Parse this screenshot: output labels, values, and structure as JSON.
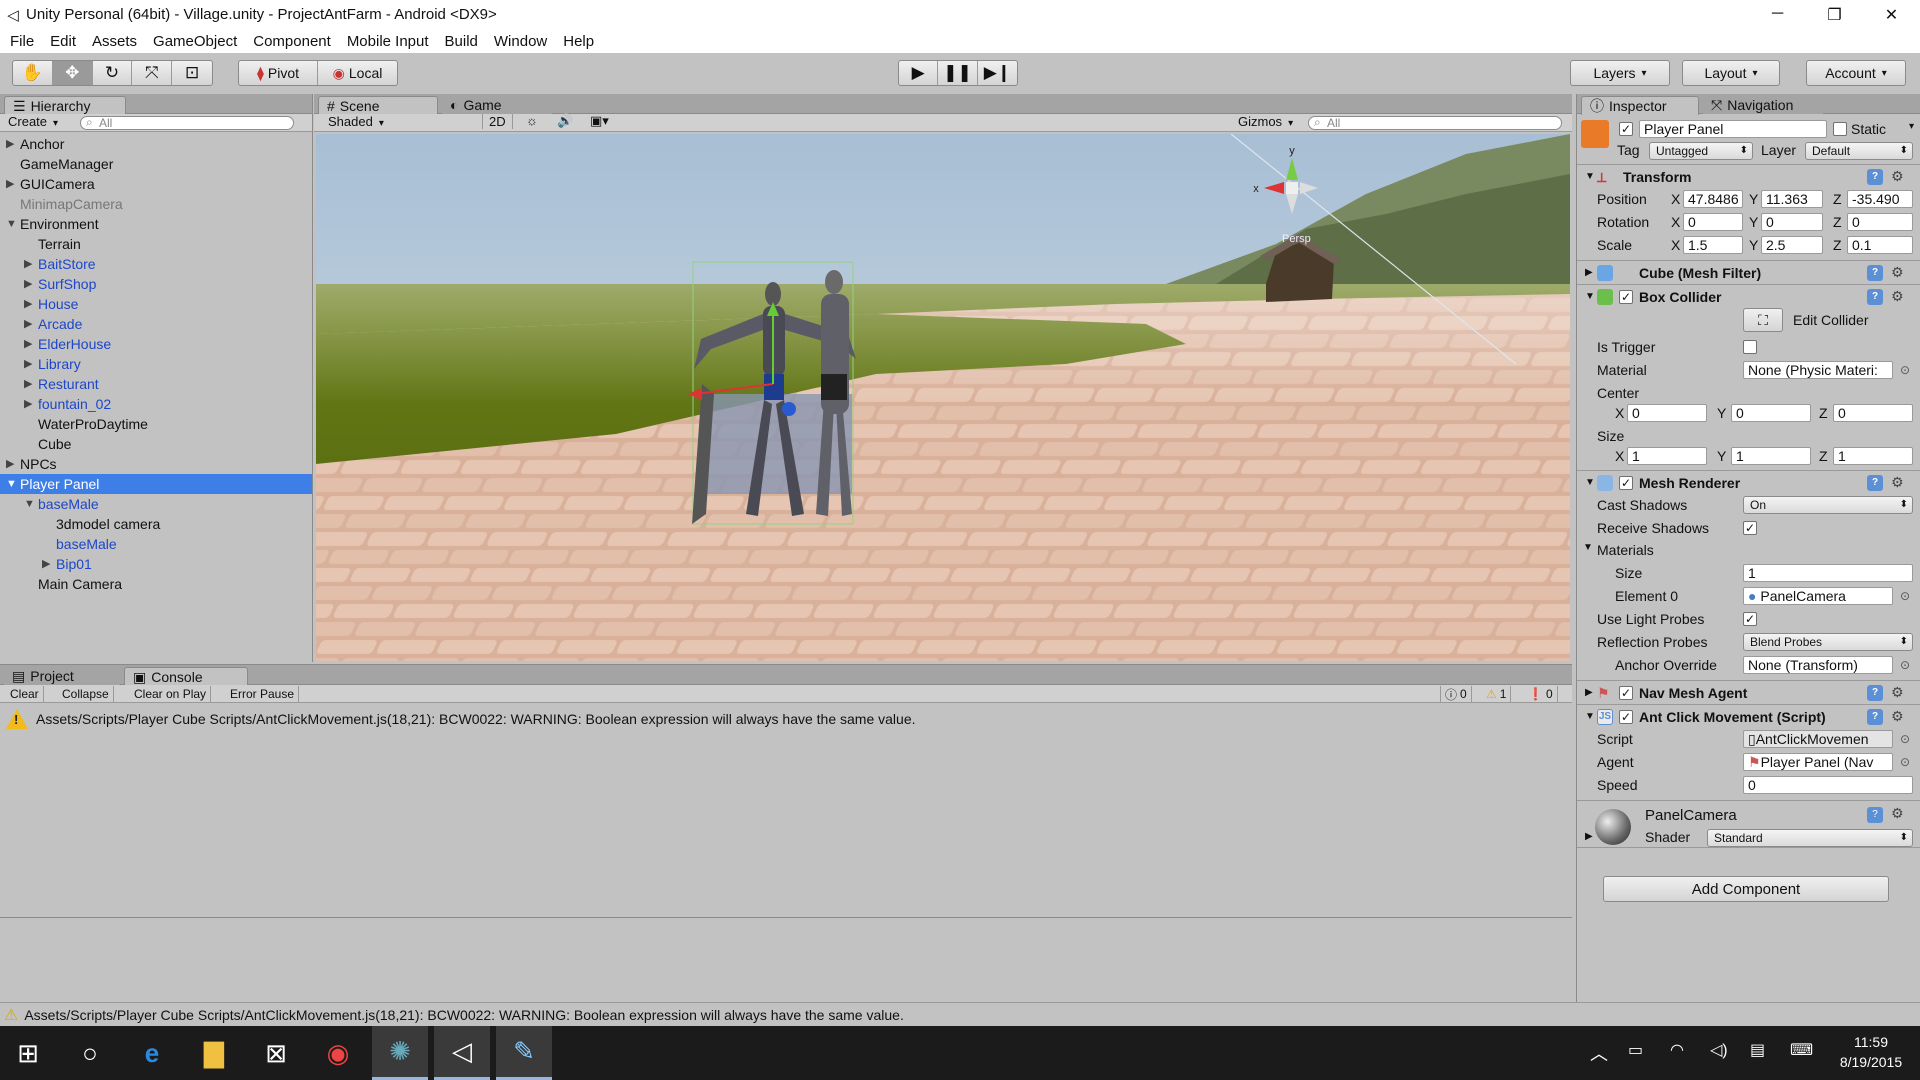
{
  "window": {
    "title": "Unity Personal (64bit) - Village.unity - ProjectAntFarm - Android <DX9>",
    "controls": [
      "─",
      "❐",
      "✕"
    ]
  },
  "menu": [
    "File",
    "Edit",
    "Assets",
    "GameObject",
    "Component",
    "Mobile Input",
    "Build",
    "Window",
    "Help"
  ],
  "toolbar": {
    "pivot": "Pivot",
    "local": "Local",
    "layers": "Layers",
    "layout": "Layout",
    "account": "Account"
  },
  "hierarchy": {
    "tab": "Hierarchy",
    "create": "Create",
    "search_placeholder": "All",
    "items": [
      {
        "label": "Anchor",
        "depth": 0,
        "arrow": "▶",
        "style": ""
      },
      {
        "label": "GameManager",
        "depth": 0,
        "arrow": "",
        "style": ""
      },
      {
        "label": "GUICamera",
        "depth": 0,
        "arrow": "▶",
        "style": ""
      },
      {
        "label": "MinimapCamera",
        "depth": 0,
        "arrow": "",
        "style": "gray"
      },
      {
        "label": "Environment",
        "depth": 0,
        "arrow": "▼",
        "style": ""
      },
      {
        "label": "Terrain",
        "depth": 1,
        "arrow": "",
        "style": ""
      },
      {
        "label": "BaitStore",
        "depth": 1,
        "arrow": "▶",
        "style": "blue"
      },
      {
        "label": "SurfShop",
        "depth": 1,
        "arrow": "▶",
        "style": "blue"
      },
      {
        "label": "House",
        "depth": 1,
        "arrow": "▶",
        "style": "blue"
      },
      {
        "label": "Arcade",
        "depth": 1,
        "arrow": "▶",
        "style": "blue"
      },
      {
        "label": "ElderHouse",
        "depth": 1,
        "arrow": "▶",
        "style": "blue"
      },
      {
        "label": "Library",
        "depth": 1,
        "arrow": "▶",
        "style": "blue"
      },
      {
        "label": "Resturant",
        "depth": 1,
        "arrow": "▶",
        "style": "blue"
      },
      {
        "label": "fountain_02",
        "depth": 1,
        "arrow": "▶",
        "style": "blue"
      },
      {
        "label": "WaterProDaytime",
        "depth": 1,
        "arrow": "",
        "style": ""
      },
      {
        "label": "Cube",
        "depth": 1,
        "arrow": "",
        "style": ""
      },
      {
        "label": "NPCs",
        "depth": 0,
        "arrow": "▶",
        "style": ""
      },
      {
        "label": "Player Panel",
        "depth": 0,
        "arrow": "▼",
        "style": "sel"
      },
      {
        "label": "baseMale",
        "depth": 1,
        "arrow": "▼",
        "style": "blue"
      },
      {
        "label": "3dmodel camera",
        "depth": 2,
        "arrow": "",
        "style": ""
      },
      {
        "label": "baseMale",
        "depth": 2,
        "arrow": "",
        "style": "blue"
      },
      {
        "label": "Bip01",
        "depth": 2,
        "arrow": "▶",
        "style": "blue"
      },
      {
        "label": "Main Camera",
        "depth": 1,
        "arrow": "",
        "style": ""
      }
    ]
  },
  "scene": {
    "tabs": [
      "Scene",
      "Game"
    ],
    "shading": "Shaded",
    "mode_2d": "2D",
    "gizmos": "Gizmos",
    "search_placeholder": "All",
    "gizmo_axes": {
      "y": "y",
      "x": "x"
    },
    "persp": "Persp"
  },
  "console": {
    "tabs": [
      "Project",
      "Console"
    ],
    "buttons": [
      "Clear",
      "Collapse",
      "Clear on Play",
      "Error Pause"
    ],
    "counts": {
      "errors": "0",
      "warnings": "1",
      "messages": "0"
    },
    "message": "Assets/Scripts/Player Cube Scripts/AntClickMovement.js(18,21): BCW0022: WARNING: Boolean expression will always have the same value."
  },
  "inspector": {
    "tabs": [
      "Inspector",
      "Navigation"
    ],
    "object_name": "Player Panel",
    "static_label": "Static",
    "tag_label": "Tag",
    "tag_value": "Untagged",
    "layer_label": "Layer",
    "layer_value": "Default",
    "transform": {
      "title": "Transform",
      "position": {
        "label": "Position",
        "x": "47.8486",
        "y": "11.363",
        "z": "-35.490"
      },
      "rotation": {
        "label": "Rotation",
        "x": "0",
        "y": "0",
        "z": "0"
      },
      "scale": {
        "label": "Scale",
        "x": "1.5",
        "y": "2.5",
        "z": "0.1"
      }
    },
    "mesh_filter": "Cube (Mesh Filter)",
    "box_collider": {
      "title": "Box Collider",
      "edit": "Edit Collider",
      "is_trigger": "Is Trigger",
      "material_label": "Material",
      "material_value": "None (Physic Materi:",
      "center_label": "Center",
      "center": {
        "x": "0",
        "y": "0",
        "z": "0"
      },
      "size_label": "Size",
      "size": {
        "x": "1",
        "y": "1",
        "z": "1"
      }
    },
    "mesh_renderer": {
      "title": "Mesh Renderer",
      "cast_shadows_label": "Cast Shadows",
      "cast_shadows_value": "On",
      "receive_shadows": "Receive Shadows",
      "materials": "Materials",
      "size_label": "Size",
      "size_value": "1",
      "element0_label": "Element 0",
      "element0_value": "PanelCamera",
      "light_probes": "Use Light Probes",
      "reflection_label": "Reflection Probes",
      "reflection_value": "Blend Probes",
      "anchor_label": "Anchor Override",
      "anchor_value": "None (Transform)"
    },
    "nav_mesh_agent": "Nav Mesh Agent",
    "ant_click": {
      "title": "Ant Click Movement (Script)",
      "script_label": "Script",
      "script_value": "AntClickMovemen",
      "agent_label": "Agent",
      "agent_value": "Player Panel (Nav",
      "speed_label": "Speed",
      "speed_value": "0"
    },
    "material": {
      "name": "PanelCamera",
      "shader_label": "Shader",
      "shader_value": "Standard"
    },
    "add_component": "Add Component"
  },
  "status": {
    "message": "Assets/Scripts/Player Cube Scripts/AntClickMovement.js(18,21): BCW0022: WARNING: Boolean expression will always have the same value."
  },
  "taskbar": {
    "time": "11:59",
    "date": "8/19/2015"
  }
}
